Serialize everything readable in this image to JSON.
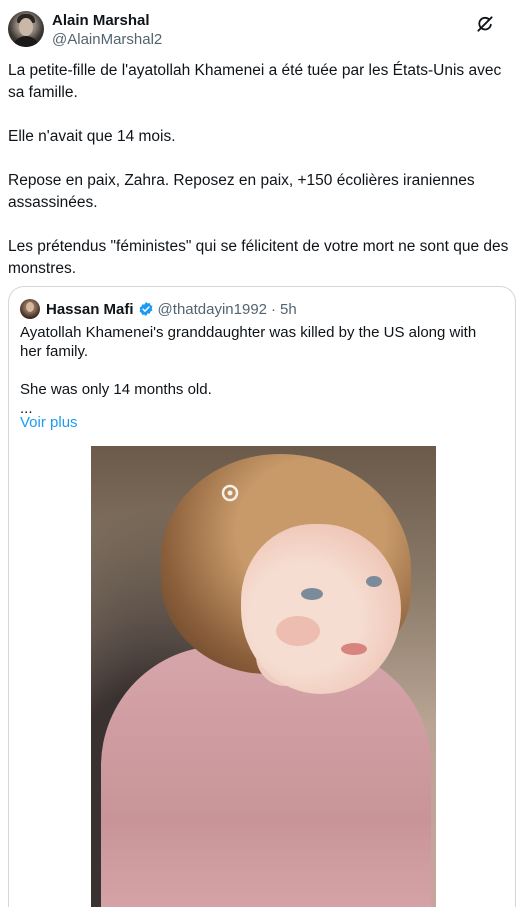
{
  "author": {
    "name": "Alain Marshal",
    "handle": "@AlainMarshal2"
  },
  "tweet": {
    "paragraphs": [
      "La petite-fille de l'ayatollah Khamenei a été tuée par les États-Unis avec sa famille.",
      "Elle n'avait que 14 mois.",
      "Repose en paix, Zahra. Reposez en paix, +150 écolières iraniennes assassinées.",
      "Les prétendus \"féministes\" qui se félicitent de votre mort ne sont que des monstres."
    ]
  },
  "quote": {
    "name": "Hassan Mafi",
    "handle": "@thatdayin1992",
    "separator": "·",
    "time": "5h",
    "line1": "Ayatollah Khamenei's granddaughter was killed by the US along with her family.",
    "line2": "She was only 14 months old.",
    "ellipsis": "...",
    "more_link": "Voir plus"
  },
  "icons": {
    "header_action": "grok-icon",
    "verified": "verified-badge-icon"
  },
  "colors": {
    "link": "#1d9bf0",
    "secondary_text": "#536471",
    "border": "#cfd9de"
  }
}
